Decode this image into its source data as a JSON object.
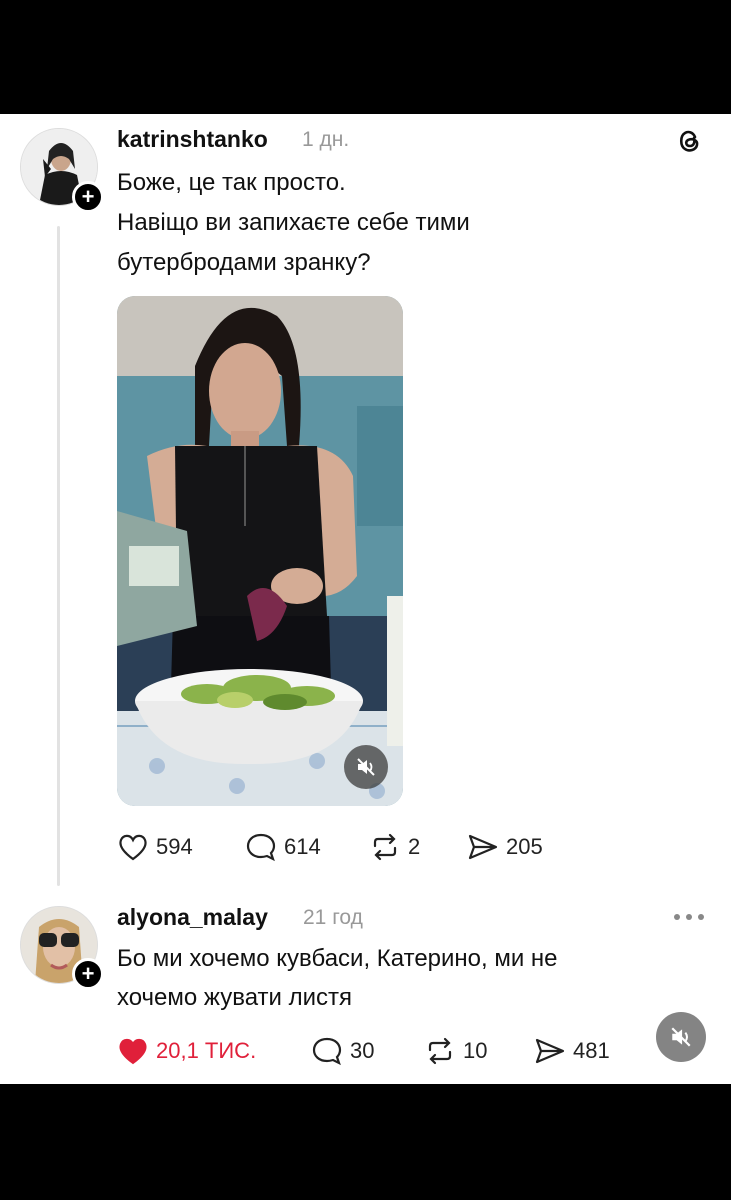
{
  "post": {
    "username": "katrinshtanko",
    "time": "1 дн.",
    "text_line1": "Боже, це так просто.",
    "text_line2": "Навіщо ви запихаєте себе тими",
    "text_line3": "бутербродами зранку?",
    "likes": "594",
    "comments": "614",
    "reposts": "2",
    "shares": "205"
  },
  "reply": {
    "username": "alyona_malay",
    "time": "21 год",
    "text_line1": "Бо ми хочемо кувбаси, Катерино, ми не",
    "text_line2": "хочемо жувати листя",
    "likes": "20,1 ТИС.",
    "comments": "30",
    "reposts": "10",
    "shares": "481"
  },
  "colors": {
    "like_active": "#e0203a",
    "text": "#111111",
    "muted": "#999999"
  },
  "icons": [
    "threads-logo-icon",
    "heart-icon",
    "comment-icon",
    "repost-icon",
    "share-icon",
    "mute-icon",
    "more-icon",
    "plus-icon"
  ]
}
